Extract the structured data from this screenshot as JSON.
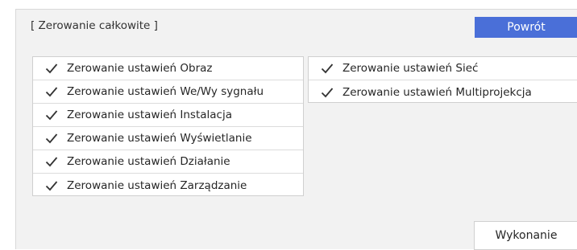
{
  "dialog": {
    "title": "[ Zerowanie całkowite ]",
    "back_label": "Powrót",
    "execute_label": "Wykonanie"
  },
  "left_items": [
    {
      "label": "Zerowanie ustawień Obraz",
      "checked": true
    },
    {
      "label": "Zerowanie ustawień We/Wy sygnału",
      "checked": true
    },
    {
      "label": "Zerowanie ustawień Instalacja",
      "checked": true
    },
    {
      "label": "Zerowanie ustawień Wyświetlanie",
      "checked": true
    },
    {
      "label": "Zerowanie ustawień Działanie",
      "checked": true
    },
    {
      "label": "Zerowanie ustawień Zarządzanie",
      "checked": true
    }
  ],
  "right_items": [
    {
      "label": "Zerowanie ustawień Sieć",
      "checked": true
    },
    {
      "label": "Zerowanie ustawień Multiprojekcja",
      "checked": true
    }
  ],
  "colors": {
    "accent": "#4a6fd8",
    "panel_bg": "#f2f2f2"
  },
  "icons": {
    "item_check": "checkmark-icon"
  }
}
